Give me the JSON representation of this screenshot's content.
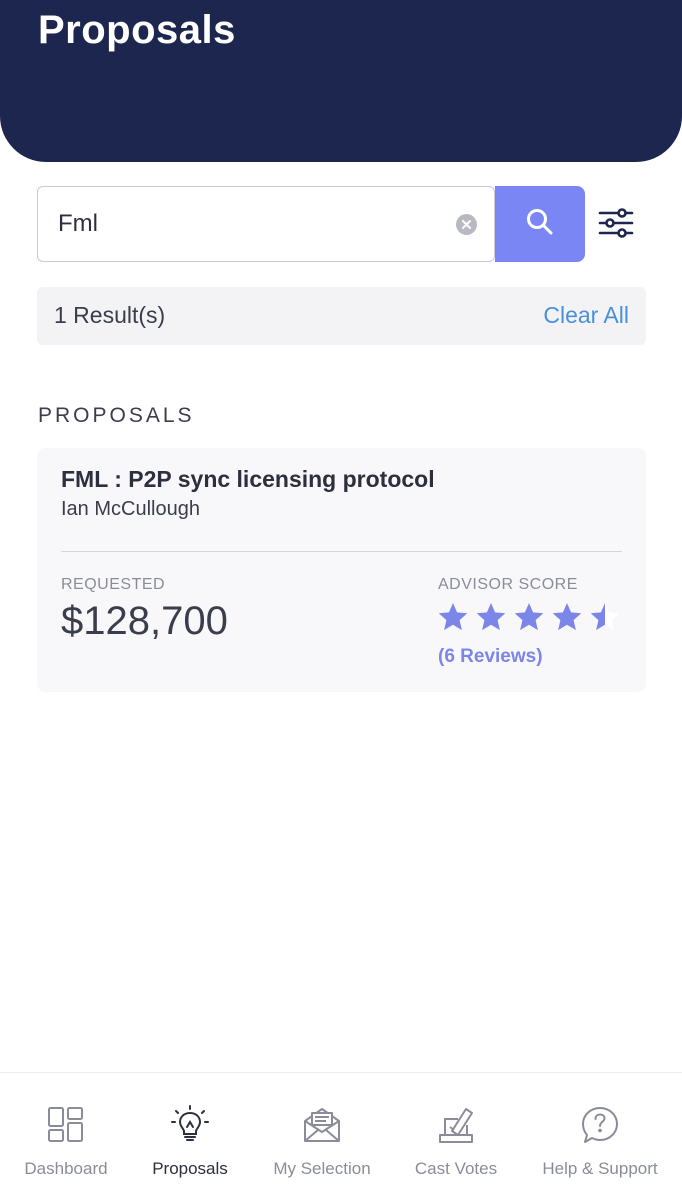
{
  "header": {
    "title": "Proposals"
  },
  "search": {
    "value": "Fml",
    "placeholder": ""
  },
  "results": {
    "count_label": "1 Result(s)",
    "clear_all_label": "Clear All"
  },
  "section": {
    "label": "PROPOSALS"
  },
  "proposals": [
    {
      "title": "FML : P2P sync licensing protocol",
      "author": "Ian McCullough",
      "requested_label": "REQUESTED",
      "requested_value": "$128,700",
      "score_label": "ADVISOR SCORE",
      "rating": 4.5,
      "rating_max": 5,
      "reviews_label": "(6 Reviews)"
    }
  ],
  "tabs": [
    {
      "label": "Dashboard",
      "icon": "dashboard-icon",
      "active": false
    },
    {
      "label": "Proposals",
      "icon": "lightbulb-icon",
      "active": true
    },
    {
      "label": "My Selection",
      "icon": "envelope-icon",
      "active": false
    },
    {
      "label": "Cast Votes",
      "icon": "ballot-icon",
      "active": false
    },
    {
      "label": "Help & Support",
      "icon": "help-bubble-icon",
      "active": false
    }
  ],
  "colors": {
    "header_bg": "#1c264e",
    "accent": "#7b86f5",
    "link": "#4a90d9",
    "star": "#7b86e8"
  }
}
